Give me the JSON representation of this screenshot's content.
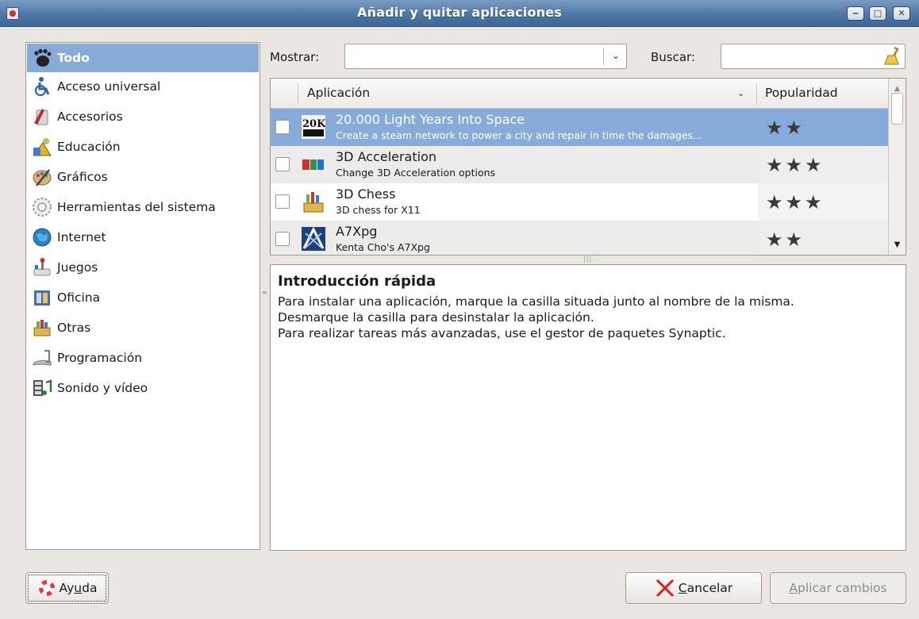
{
  "window": {
    "title": "Añadir y quitar aplicaciones",
    "controls": {
      "minimize": "‒",
      "maximize": "□",
      "close": "✕"
    }
  },
  "categories": [
    {
      "label": "Todo",
      "icon": "gnome-foot-icon",
      "selected": true
    },
    {
      "label": "Acceso universal",
      "icon": "accessibility-icon"
    },
    {
      "label": "Accesorios",
      "icon": "accessories-icon"
    },
    {
      "label": "Educación",
      "icon": "education-icon"
    },
    {
      "label": "Gráficos",
      "icon": "graphics-palette-icon"
    },
    {
      "label": "Herramientas del sistema",
      "icon": "system-gear-icon"
    },
    {
      "label": "Internet",
      "icon": "globe-icon"
    },
    {
      "label": "Juegos",
      "icon": "joystick-icon"
    },
    {
      "label": "Oficina",
      "icon": "office-icon"
    },
    {
      "label": "Otras",
      "icon": "other-box-icon"
    },
    {
      "label": "Programación",
      "icon": "programming-icon"
    },
    {
      "label": "Sonido y vídeo",
      "icon": "multimedia-icon"
    }
  ],
  "filter": {
    "show_label": "Mostrar:",
    "show_value": "",
    "search_label": "Buscar:",
    "search_value": ""
  },
  "table": {
    "col_app": "Aplicación",
    "col_popularity": "Popularidad",
    "rows": [
      {
        "name": "20.000 Light Years Into Space",
        "desc": "Create a steam network to power a city and repair in time the damages...",
        "stars": "★★",
        "icon": "20k-logo-icon",
        "selected": true,
        "checked": false
      },
      {
        "name": "3D Acceleration",
        "desc": "Change 3D Acceleration options",
        "stars": "★★★",
        "icon": "dri-logo-icon",
        "selected": false,
        "checked": false
      },
      {
        "name": "3D Chess",
        "desc": "3D chess for X11",
        "stars": "★★★",
        "icon": "chess-icon",
        "selected": false,
        "checked": false
      },
      {
        "name": "A7Xpg",
        "desc": "Kenta Cho's A7Xpg",
        "stars": "★★",
        "icon": "a7xpg-logo-icon",
        "selected": false,
        "checked": false
      }
    ]
  },
  "intro": {
    "title": "Introducción rápida",
    "lines": [
      "Para instalar una aplicación, marque la casilla situada junto al nombre de la misma.",
      "Desmarque la casilla para desinstalar la aplicación.",
      "Para realizar tareas más avanzadas, use el gestor de paquetes Synaptic."
    ]
  },
  "buttons": {
    "help_pre": "Ay",
    "help_mnemonic": "u",
    "help_post": "da",
    "cancel_mnemonic": "C",
    "cancel_post": "ancelar",
    "apply_mnemonic": "A",
    "apply_post": "plicar cambios"
  },
  "colors": {
    "selection": "#86abd9",
    "titlebar": "#4f77a6"
  }
}
